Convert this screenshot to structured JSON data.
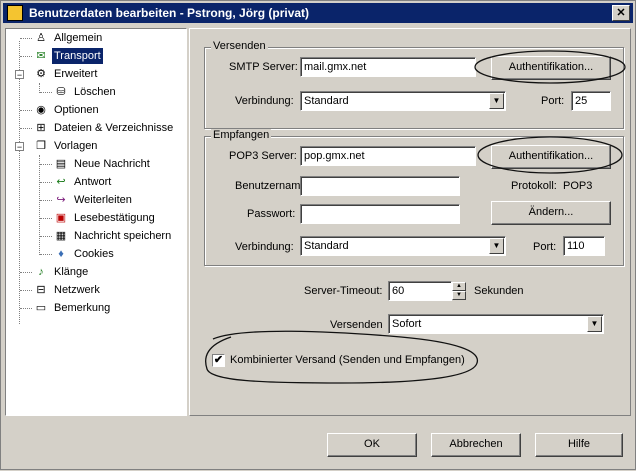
{
  "window": {
    "title": "Benutzerdaten bearbeiten - Pstrong, Jörg (privat)",
    "close_glyph": "✕"
  },
  "tree": {
    "items": [
      {
        "label": "Allgemein",
        "icon": "person-icon"
      },
      {
        "label": "Transport",
        "icon": "transport-icon",
        "selected": true
      },
      {
        "label": "Erweitert",
        "icon": "network-icon"
      },
      {
        "label": "Löschen",
        "icon": "database-icon"
      },
      {
        "label": "Optionen",
        "icon": "options-icon"
      },
      {
        "label": "Dateien & Verzeichnisse",
        "icon": "folders-icon"
      },
      {
        "label": "Vorlagen",
        "icon": "templates-icon"
      },
      {
        "label": "Neue Nachricht",
        "icon": "document-icon"
      },
      {
        "label": "Antwort",
        "icon": "reply-icon"
      },
      {
        "label": "Weiterleiten",
        "icon": "forward-icon"
      },
      {
        "label": "Lesebestätigung",
        "icon": "receipt-icon"
      },
      {
        "label": "Nachricht speichern",
        "icon": "save-icon"
      },
      {
        "label": "Cookies",
        "icon": "cookie-icon"
      },
      {
        "label": "Klänge",
        "icon": "sound-icon"
      },
      {
        "label": "Netzwerk",
        "icon": "network-icon"
      },
      {
        "label": "Bemerkung",
        "icon": "note-icon"
      }
    ]
  },
  "versenden": {
    "group_title": "Versenden",
    "smtp_label": "SMTP Server:",
    "smtp_value": "mail.gmx.net",
    "auth_button": "Authentifikation...",
    "connection_label": "Verbindung:",
    "connection_value": "Standard",
    "port_label": "Port:",
    "port_value": "25"
  },
  "empfangen": {
    "group_title": "Empfangen",
    "pop3_label": "POP3 Server:",
    "pop3_value": "pop.gmx.net",
    "auth_button": "Authentifikation...",
    "username_label": "Benutzername:",
    "username_value": "",
    "protocol_label": "Protokoll:",
    "protocol_value": "POP3",
    "password_label": "Passwort:",
    "password_value": "",
    "change_button": "Ändern...",
    "connection_label": "Verbindung:",
    "connection_value": "Standard",
    "port_label": "Port:",
    "port_value": "110"
  },
  "general": {
    "timeout_label": "Server-Timeout:",
    "timeout_value": "60",
    "timeout_unit": "Sekunden",
    "send_label": "Versenden",
    "send_value": "Sofort",
    "combined_label": "Kombinierter Versand (Senden und Empfangen)",
    "combined_checked": true
  },
  "buttons": {
    "ok": "OK",
    "cancel": "Abbrechen",
    "help": "Hilfe"
  }
}
